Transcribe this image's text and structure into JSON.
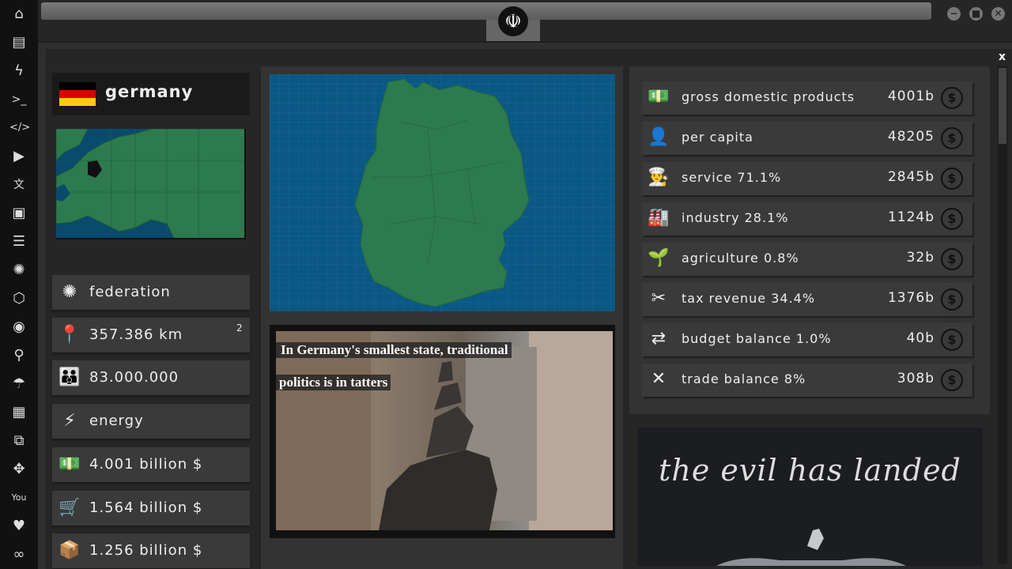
{
  "sidebar": {
    "icons": [
      "home-icon",
      "document-icon",
      "lightning-icon",
      "terminal-icon",
      "code-icon",
      "play-icon",
      "translate-icon",
      "image-icon",
      "news-icon",
      "empire-icon",
      "hexagon-icon",
      "globe-icon",
      "search-icon",
      "umbrella-icon",
      "contacts-icon",
      "link-icon",
      "expand-icon",
      "youtube-icon",
      "heart-icon",
      "infinity-icon"
    ]
  },
  "window": {
    "close_label": "x",
    "logo_glyph": "☫"
  },
  "country": {
    "name": "germany",
    "flag_colors": [
      "#000000",
      "#dd0000",
      "#ffce00"
    ]
  },
  "stats": [
    {
      "name": "government-row",
      "icon": "empire-emblem-icon",
      "text": "federation"
    },
    {
      "name": "area-row",
      "icon": "map-pin-icon",
      "text": "357.386 km",
      "sup": "2"
    },
    {
      "name": "population-row",
      "icon": "people-icon",
      "text": "83.000.000"
    },
    {
      "name": "energy-row",
      "icon": "lightning-icon",
      "text": "energy"
    },
    {
      "name": "gdp-row",
      "icon": "money-stack-icon",
      "text": "4.001 billion $"
    },
    {
      "name": "import-row",
      "icon": "cargo-cart-icon",
      "text": "1.564 billion $"
    },
    {
      "name": "export-row",
      "icon": "package-icon",
      "text": "1.256 billion $"
    }
  ],
  "news": {
    "line1": "In Germany's smallest state, traditional",
    "line2": "politics is in tatters"
  },
  "economy": [
    {
      "icon": "money-stack-icon",
      "label": "gross domestic products",
      "value": "4001b"
    },
    {
      "icon": "person-icon",
      "label": "per capita",
      "value": "48205"
    },
    {
      "icon": "chef-icon",
      "label": "service 71.1%",
      "value": "2845b"
    },
    {
      "icon": "factory-icon",
      "label": "industry 28.1%",
      "value": "1124b"
    },
    {
      "icon": "sprout-icon",
      "label": "agriculture 0.8%",
      "value": "32b"
    },
    {
      "icon": "scissors-money-icon",
      "label": "tax revenue 34.4%",
      "value": "1376b"
    },
    {
      "icon": "exchange-icon",
      "label": "budget balance 1.0%",
      "value": "40b"
    },
    {
      "icon": "trade-cross-icon",
      "label": "trade balance 8%",
      "value": "308b"
    }
  ],
  "video": {
    "title": "the evil has landed"
  },
  "colors": {
    "map_water": "#0a5883",
    "map_land": "#2d7a4f"
  }
}
